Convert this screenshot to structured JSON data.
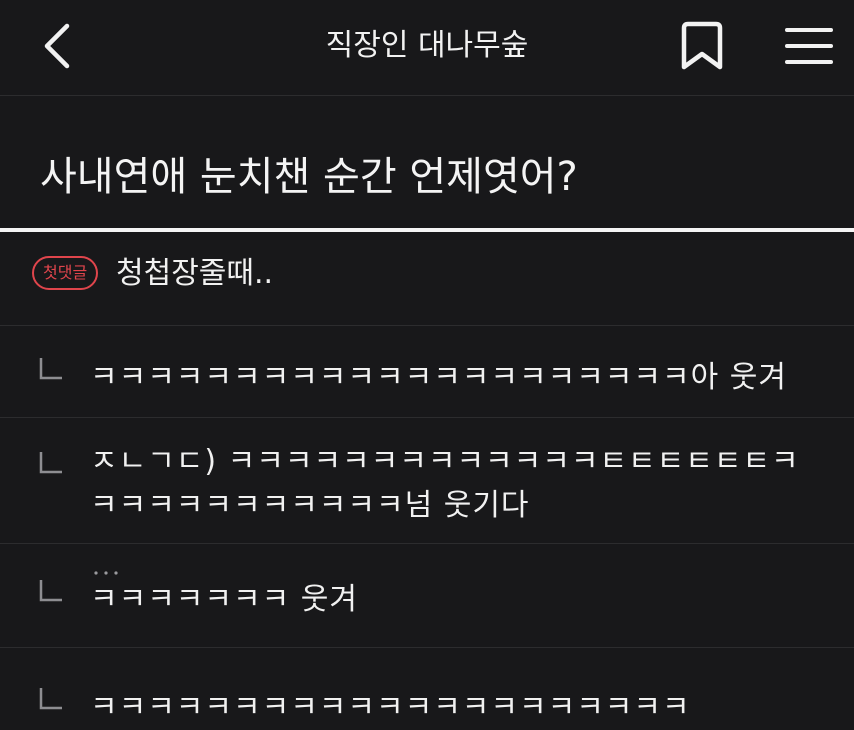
{
  "header": {
    "title": "직장인 대나무숲",
    "back_icon": "chevron-left-icon",
    "bookmark_icon": "bookmark-icon",
    "menu_icon": "hamburger-menu-icon"
  },
  "post": {
    "title": "사내연애 눈치챈 순간 언제엿어?"
  },
  "first_comment": {
    "badge": "첫댓글",
    "text": "청첩장줄때.."
  },
  "replies": [
    {
      "line1": "ㅋㅋㅋㅋㅋㅋㅋㅋㅋㅋㅋㅋㅋㅋㅋㅋㅋㅋㅋㅋㅋ아 웃겨",
      "line2": ""
    },
    {
      "line1": "ㅈㄴㄱㄷ) ㅋㅋㅋㅋㅋㅋㅋㅋㅋㅋㅋㅋㅋㅌㅌㅌㅌㅌㅌㅋ",
      "line2": "ㅋㅋㅋㅋㅋㅋㅋㅋㅋㅋㅋ넘 웃기다"
    },
    {
      "line1": "ㅋㅋㅋㅋㅋㅋㅋ 웃겨",
      "line2": ""
    },
    {
      "line1": "ㅋㅋㅋㅋㅋㅋㅋㅋㅋㅋㅋㅋㅋㅋㅋㅋㅋㅋㅋㅋㅋ",
      "line2": ""
    }
  ],
  "colors": {
    "background": "#18181a",
    "badge": "#e0454c",
    "text": "#f1f1f1",
    "divider": "#2c2c2e"
  }
}
